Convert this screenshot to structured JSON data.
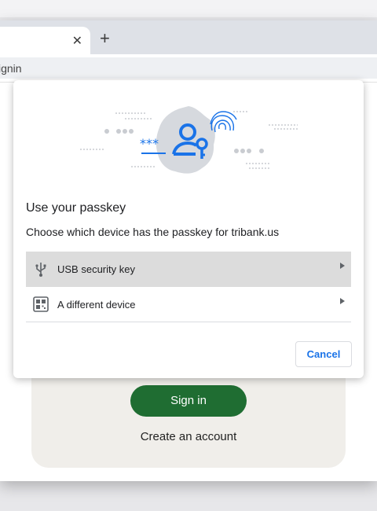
{
  "browser": {
    "tab_close_glyph": "✕",
    "new_tab_glyph": "+",
    "url_text": "ignin"
  },
  "page": {
    "signin_label": "Sign in",
    "create_account_label": "Create an account"
  },
  "dialog": {
    "title": "Use your passkey",
    "subtitle": "Choose which device has the passkey for tribank.us",
    "options": [
      {
        "label": "USB security key",
        "icon": "usb-icon",
        "selected": true
      },
      {
        "label": "A different device",
        "icon": "qr-code-icon",
        "selected": false
      }
    ],
    "cancel_label": "Cancel"
  },
  "colors": {
    "accent": "#1a73e8",
    "signin_bg": "#1f6d32",
    "illustration_blue": "#1a73e8"
  }
}
